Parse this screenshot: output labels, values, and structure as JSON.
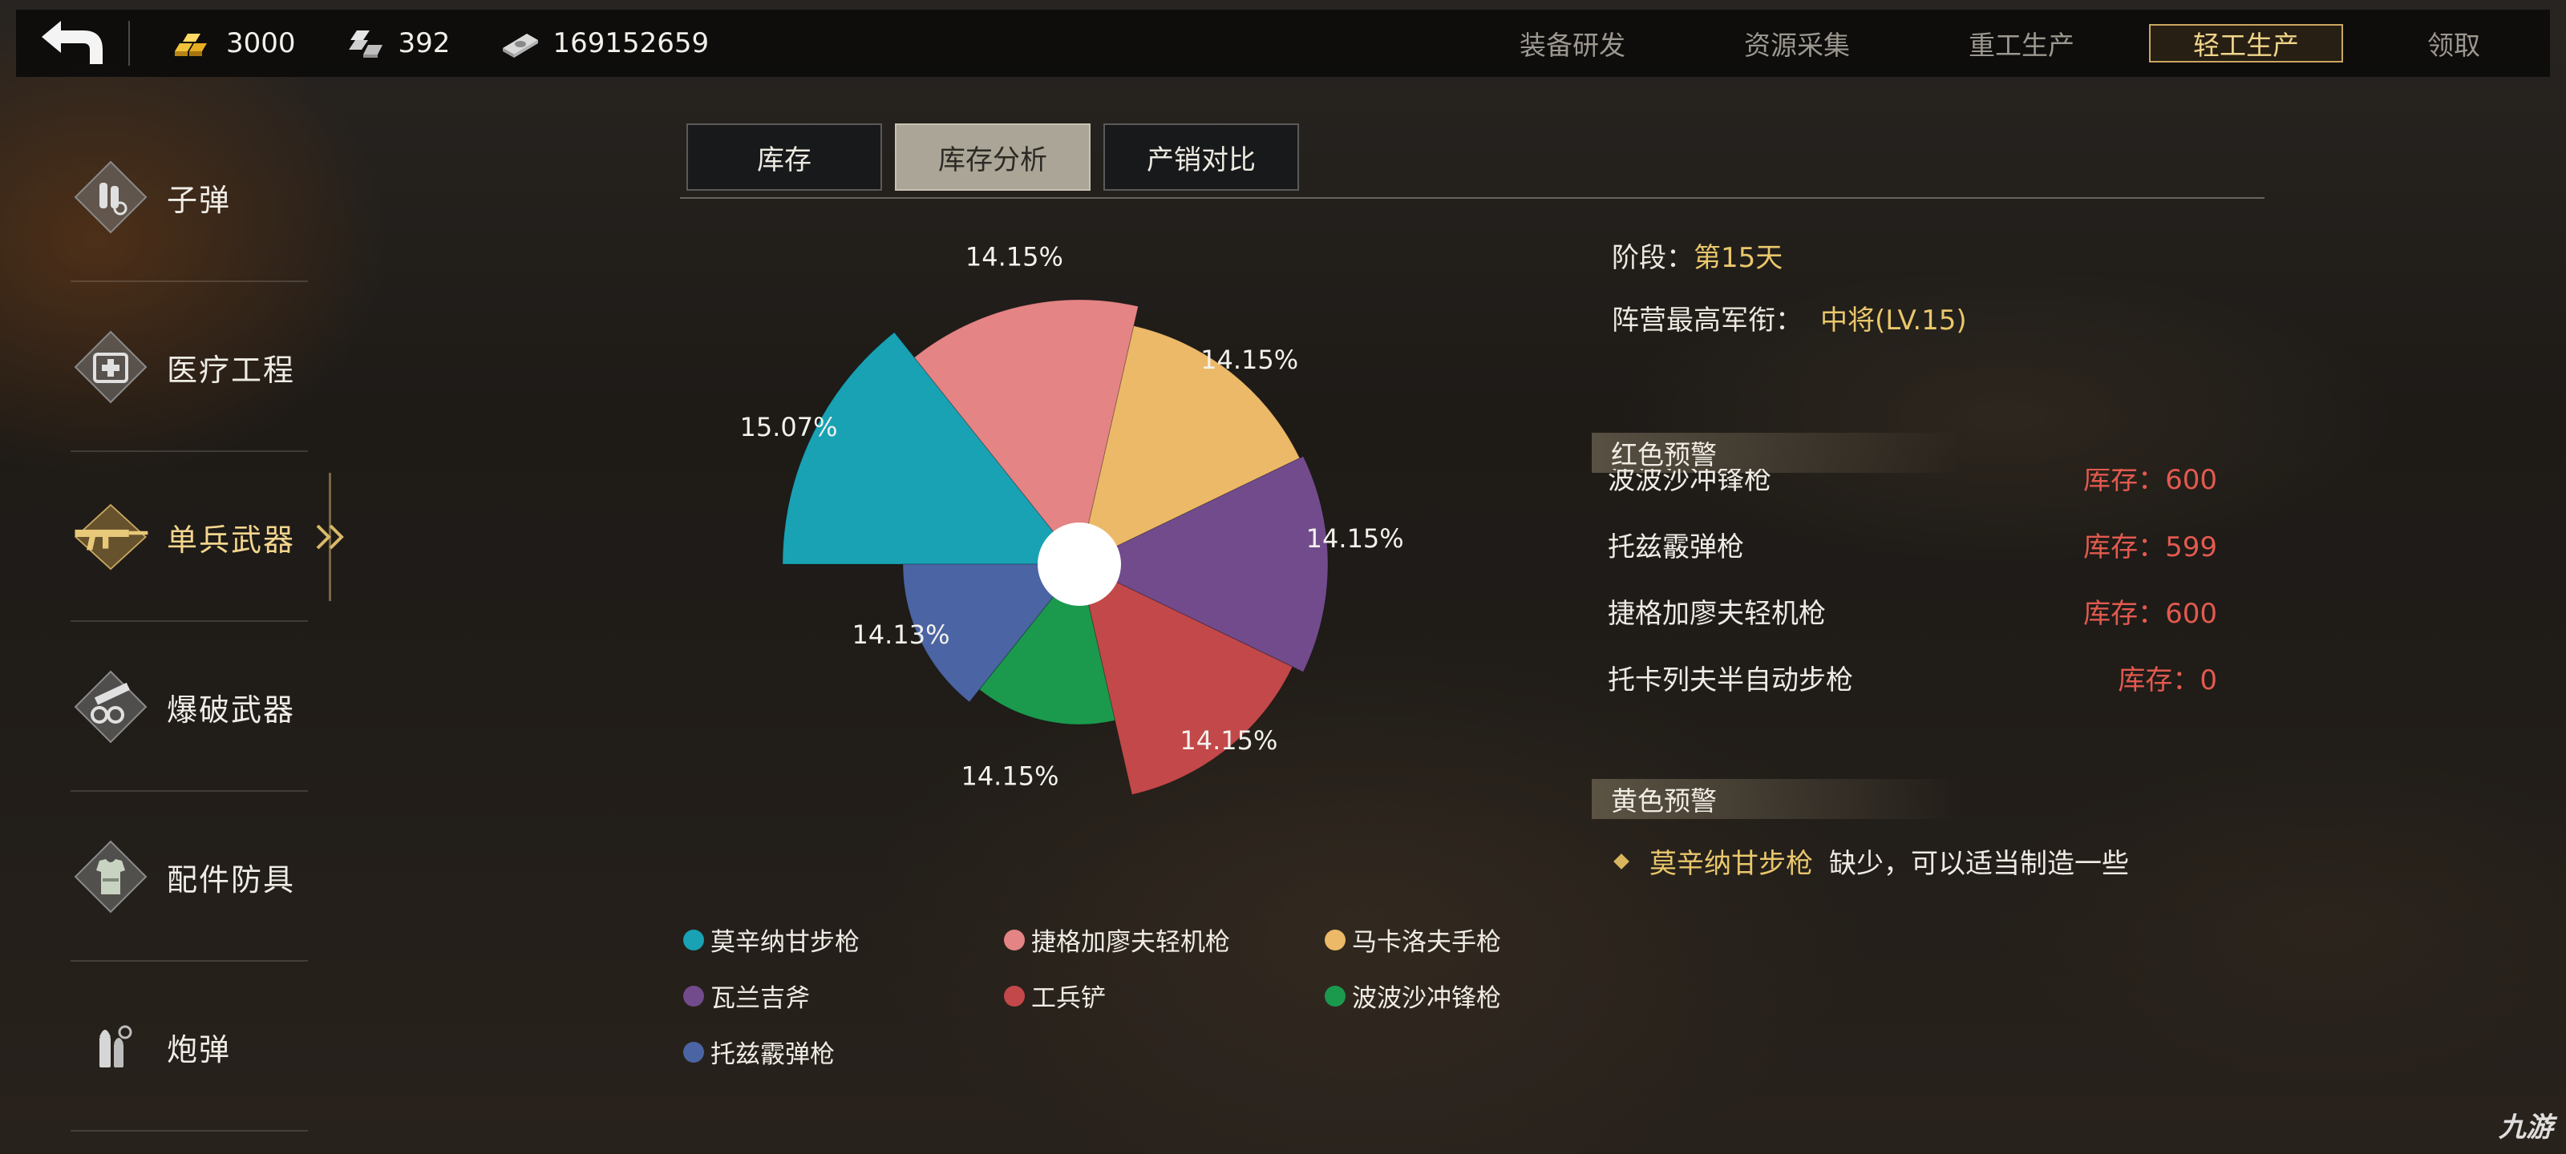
{
  "topbar": {
    "resources": [
      {
        "icon": "gold-bars-icon",
        "value": "3000"
      },
      {
        "icon": "silver-bars-icon",
        "value": "392"
      },
      {
        "icon": "money-stack-icon",
        "value": "169152659"
      }
    ],
    "tabs": [
      {
        "label": "装备研发",
        "active": false
      },
      {
        "label": "资源采集",
        "active": false
      },
      {
        "label": "重工生产",
        "active": false
      },
      {
        "label": "轻工生产",
        "active": true
      },
      {
        "label": "领取",
        "active": false
      }
    ]
  },
  "sidebar": {
    "items": [
      {
        "label": "子弹",
        "icon": "bullet-icon",
        "active": false
      },
      {
        "label": "医疗工程",
        "icon": "medical-kit-icon",
        "active": false
      },
      {
        "label": "单兵武器",
        "icon": "rifle-icon",
        "active": true
      },
      {
        "label": "爆破武器",
        "icon": "cannon-icon",
        "active": false
      },
      {
        "label": "配件防具",
        "icon": "armor-vest-icon",
        "active": false
      },
      {
        "label": "炮弹",
        "icon": "shell-icon",
        "active": false
      }
    ]
  },
  "subtabs": [
    {
      "label": "库存",
      "active": false
    },
    {
      "label": "库存分析",
      "active": true
    },
    {
      "label": "产销对比",
      "active": false
    }
  ],
  "chart_data": {
    "type": "pie",
    "variant": "rose",
    "legend_position": "bottom",
    "series": [
      {
        "name": "莫辛纳甘步枪",
        "percent": 15.07,
        "label": "15.07%",
        "color": "#18a2b4"
      },
      {
        "name": "捷格加廖夫轻机枪",
        "percent": 14.15,
        "label": "14.15%",
        "color": "#e48485"
      },
      {
        "name": "马卡洛夫手枪",
        "percent": 14.15,
        "label": "14.15%",
        "color": "#ecb968"
      },
      {
        "name": "瓦兰吉斧",
        "percent": 14.15,
        "label": "14.15%",
        "color": "#714b8c"
      },
      {
        "name": "工兵铲",
        "percent": 14.15,
        "label": "14.15%",
        "color": "#c2484a"
      },
      {
        "name": "波波沙冲锋枪",
        "percent": 14.15,
        "label": "14.15%",
        "color": "#1b9a4e"
      },
      {
        "name": "托兹霰弹枪",
        "percent": 14.13,
        "label": "14.13%",
        "color": "#4b64a3"
      }
    ]
  },
  "info": {
    "stage_label": "阶段：",
    "stage_value": "第15天",
    "rank_label": "阵营最高军衔：",
    "rank_value": "中将(LV.15)"
  },
  "red_warning": {
    "title": "红色预警",
    "rows": [
      {
        "name": "波波沙冲锋枪",
        "stock": "库存：600"
      },
      {
        "name": "托兹霰弹枪",
        "stock": "库存：599"
      },
      {
        "name": "捷格加廖夫轻机枪",
        "stock": "库存：600"
      },
      {
        "name": "托卡列夫半自动步枪",
        "stock": "库存：0"
      }
    ]
  },
  "yellow_warning": {
    "title": "黄色预警",
    "item": "莫辛纳甘步枪",
    "desc": "缺少，可以适当制造一些"
  },
  "watermark": "九游"
}
